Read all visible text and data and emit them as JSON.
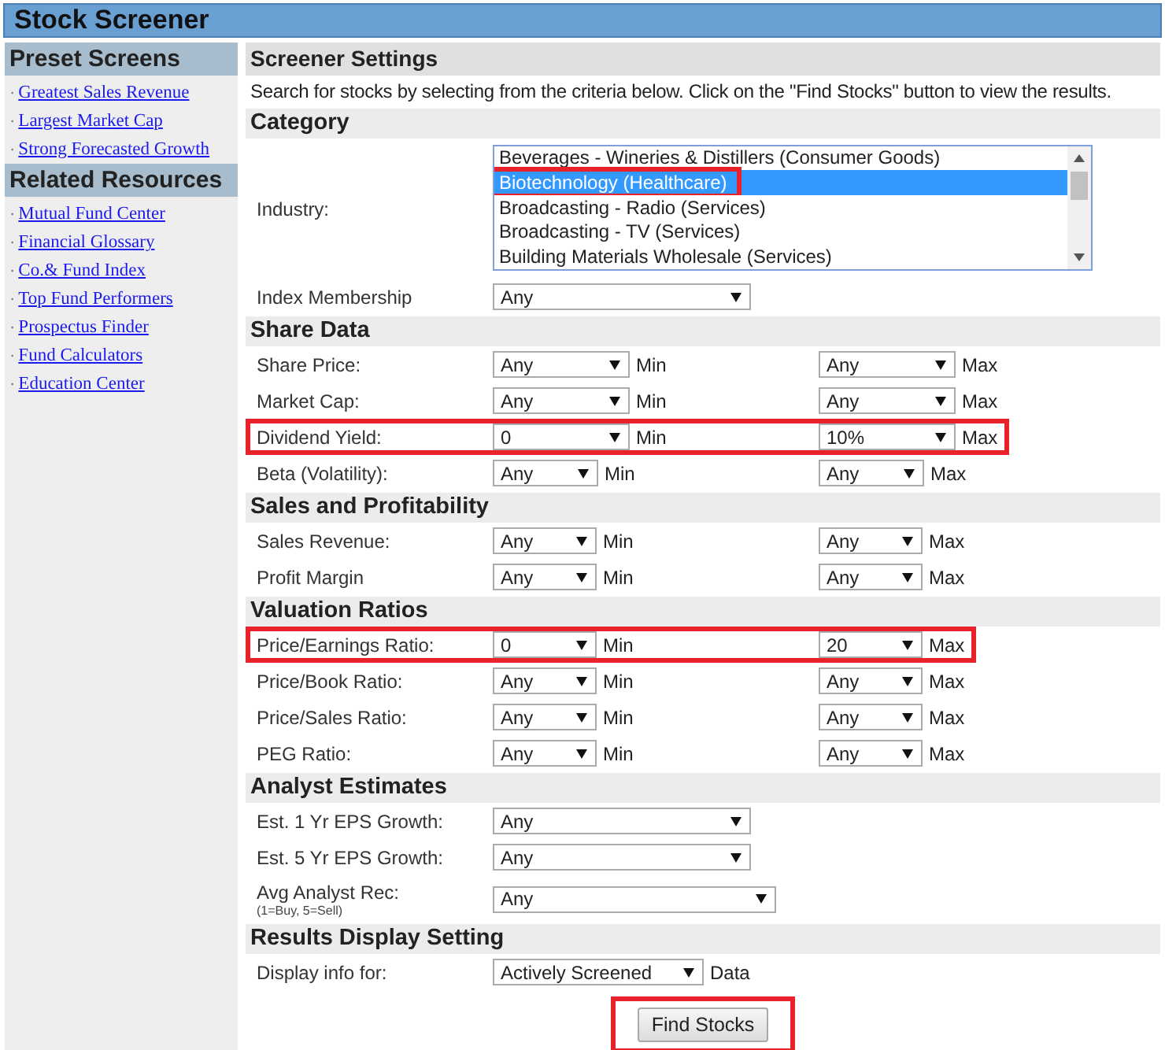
{
  "header": {
    "title": "Stock Screener"
  },
  "sidebar": {
    "sections": [
      {
        "title": "Preset Screens",
        "links": [
          {
            "bullet": "·",
            "label": "Greatest Sales Revenue"
          },
          {
            "bullet": "·",
            "label": "Largest Market Cap"
          },
          {
            "bullet": "·",
            "label": "Strong Forecasted Growth"
          }
        ]
      },
      {
        "title": "Related Resources",
        "links": [
          {
            "bullet": "·",
            "label": "Mutual Fund Center"
          },
          {
            "bullet": "·",
            "label": "Financial Glossary"
          },
          {
            "bullet": "·",
            "label": "Co.& Fund Index"
          },
          {
            "bullet": "·",
            "label": "Top Fund Performers"
          },
          {
            "bullet": "·",
            "label": "Prospectus Finder"
          },
          {
            "bullet": "·",
            "label": "Fund Calculators"
          },
          {
            "bullet": "·",
            "label": "Education Center"
          }
        ]
      }
    ]
  },
  "main": {
    "title": "Screener Settings",
    "intro": "Search for stocks by selecting from the criteria below. Click on the \"Find Stocks\" button to view the results.",
    "sections": [
      {
        "title": "Category",
        "rows": [
          {
            "kind": "listbox",
            "label": "Industry:",
            "options": [
              {
                "label": "Beverages - Wineries & Distillers (Consumer Goods)",
                "selected": false,
                "highlighted": false
              },
              {
                "label": "Biotechnology (Healthcare)",
                "selected": true,
                "highlighted": true
              },
              {
                "label": "Broadcasting - Radio (Services)",
                "selected": false,
                "highlighted": false
              },
              {
                "label": "Broadcasting - TV (Services)",
                "selected": false,
                "highlighted": false
              },
              {
                "label": "Building Materials Wholesale (Services)",
                "selected": false,
                "highlighted": false
              }
            ]
          },
          {
            "kind": "single",
            "label": "Index Membership",
            "value": "Any",
            "highlighted": false
          }
        ]
      },
      {
        "title": "Share Data",
        "rows": [
          {
            "kind": "range",
            "label": "Share Price:",
            "min": "Any",
            "min_label": "Min",
            "max": "Any",
            "max_label": "Max",
            "highlighted": false
          },
          {
            "kind": "range",
            "label": "Market Cap:",
            "min": "Any",
            "min_label": "Min",
            "max": "Any",
            "max_label": "Max",
            "highlighted": false
          },
          {
            "kind": "range",
            "label": "Dividend Yield:",
            "min": "0",
            "min_label": "Min",
            "max": "10%",
            "max_label": "Max",
            "highlighted": true
          },
          {
            "kind": "range",
            "label": "Beta (Volatility):",
            "min": "Any",
            "min_label": "Min",
            "max": "Any",
            "max_label": "Max",
            "highlighted": false
          }
        ]
      },
      {
        "title": "Sales and Profitability",
        "rows": [
          {
            "kind": "range",
            "label": "Sales Revenue:",
            "min": "Any",
            "min_label": "Min",
            "max": "Any",
            "max_label": "Max",
            "highlighted": false
          },
          {
            "kind": "range",
            "label": "Profit Margin",
            "min": "Any",
            "min_label": "Min",
            "max": "Any",
            "max_label": "Max",
            "highlighted": false
          }
        ]
      },
      {
        "title": "Valuation Ratios",
        "rows": [
          {
            "kind": "range",
            "label": "Price/Earnings Ratio:",
            "min": "0",
            "min_label": "Min",
            "max": "20",
            "max_label": "Max",
            "highlighted": true
          },
          {
            "kind": "range",
            "label": "Price/Book Ratio:",
            "min": "Any",
            "min_label": "Min",
            "max": "Any",
            "max_label": "Max",
            "highlighted": false
          },
          {
            "kind": "range",
            "label": "Price/Sales Ratio:",
            "min": "Any",
            "min_label": "Min",
            "max": "Any",
            "max_label": "Max",
            "highlighted": false
          },
          {
            "kind": "range",
            "label": "PEG Ratio:",
            "min": "Any",
            "min_label": "Min",
            "max": "Any",
            "max_label": "Max",
            "highlighted": false
          }
        ]
      },
      {
        "title": "Analyst Estimates",
        "rows": [
          {
            "kind": "single",
            "label": "Est. 1 Yr EPS Growth:",
            "value": "Any",
            "highlighted": false
          },
          {
            "kind": "single",
            "label": "Est. 5 Yr EPS Growth:",
            "value": "Any",
            "highlighted": false
          },
          {
            "kind": "single",
            "label": "Avg Analyst Rec:",
            "note": "(1=Buy, 5=Sell)",
            "value": "Any",
            "highlighted": false
          }
        ]
      },
      {
        "title": "Results Display Setting",
        "rows": [
          {
            "kind": "single",
            "label": "Display info for:",
            "value": "Actively Screened",
            "suffix": "Data",
            "highlighted": false
          }
        ]
      }
    ],
    "button": {
      "label": "Find Stocks",
      "highlighted": true
    }
  }
}
